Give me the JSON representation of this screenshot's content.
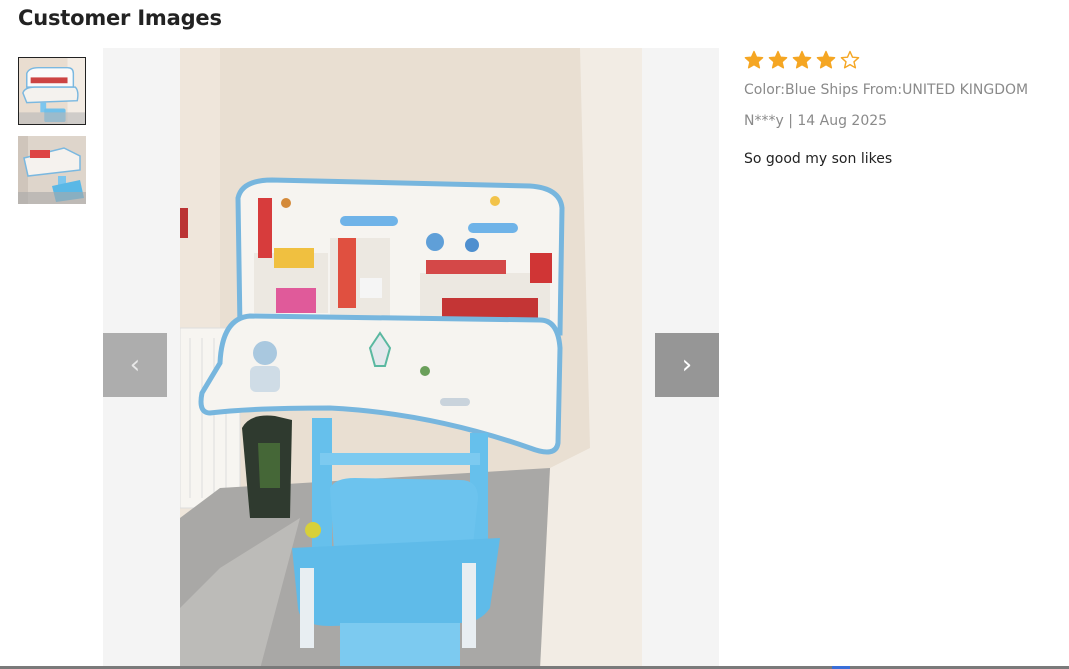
{
  "page": {
    "title": "Customer Images"
  },
  "gallery": {
    "thumbnails": [
      {
        "label": "thumbnail-1",
        "active": true
      },
      {
        "label": "thumbnail-2",
        "active": false
      }
    ],
    "prev_icon": "‹",
    "next_icon": "›"
  },
  "review": {
    "rating": 4,
    "rating_max": 5,
    "star_color": "#f5a623",
    "attributes": "Color:Blue Ships From:UNITED KINGDOM",
    "author_date": "N***y | 14 Aug 2025",
    "text": "So good my son likes"
  }
}
